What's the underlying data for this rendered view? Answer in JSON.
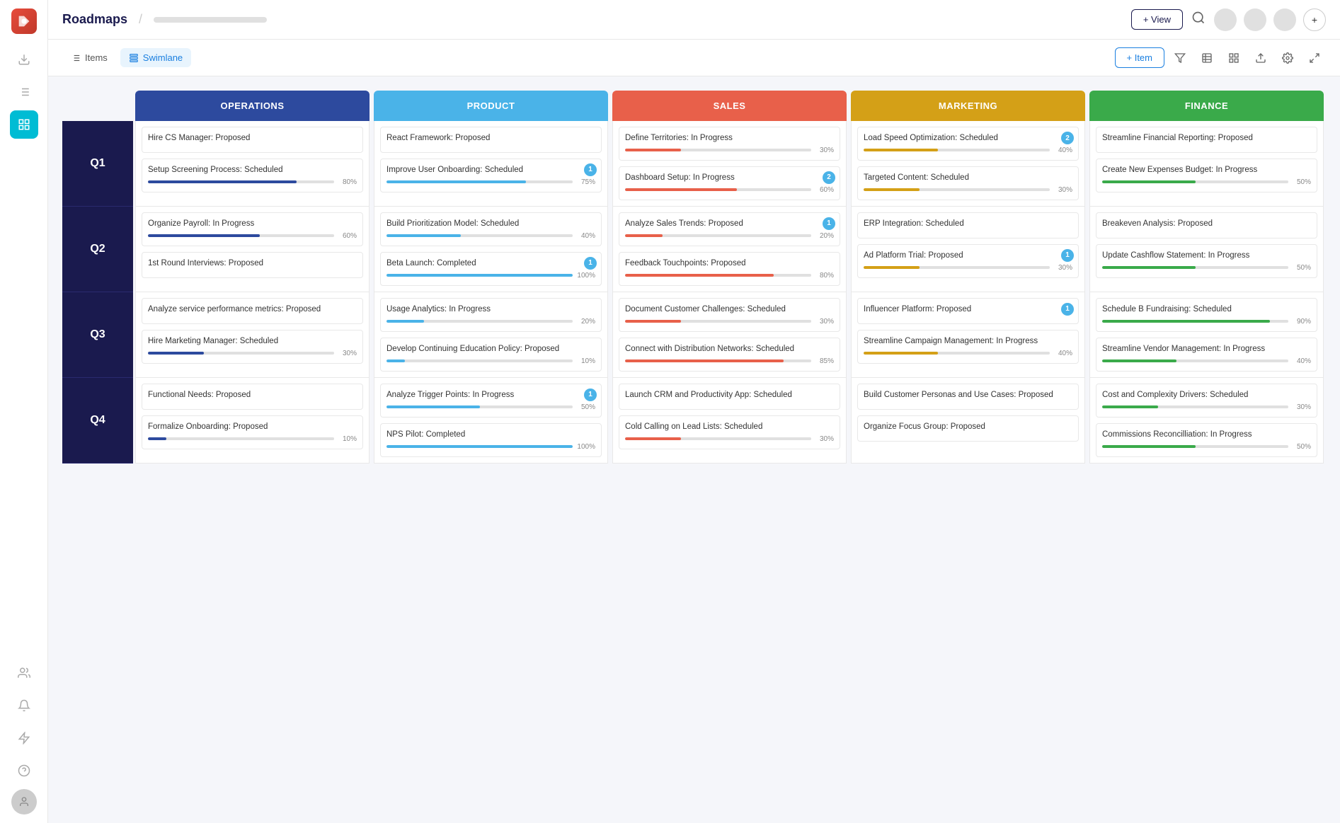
{
  "app": {
    "logo_alt": "Roadmaps App",
    "title": "Roadmaps",
    "breadcrumb_placeholder": ""
  },
  "topbar": {
    "title": "Roadmaps",
    "add_view_label": "+ View",
    "search_icon": "search",
    "user_icons": [
      "user1",
      "user2",
      "user3"
    ],
    "add_icon": "+"
  },
  "toolbar": {
    "items_label": "Items",
    "swimlane_label": "Swimlane",
    "add_item_label": "+ Item",
    "icons": [
      "filter",
      "table",
      "layout",
      "export",
      "settings",
      "expand"
    ]
  },
  "columns": [
    {
      "id": "operations",
      "label": "OPERATIONS",
      "class": "operations"
    },
    {
      "id": "product",
      "label": "PRODUCT",
      "class": "product"
    },
    {
      "id": "sales",
      "label": "SALES",
      "class": "sales"
    },
    {
      "id": "marketing",
      "label": "MARKETING",
      "class": "marketing"
    },
    {
      "id": "finance",
      "label": "FINANCE",
      "class": "finance"
    }
  ],
  "quarters": [
    {
      "label": "Q1",
      "cells": [
        {
          "col": "operations",
          "cards": [
            {
              "title": "Hire CS Manager: Proposed",
              "badge": null,
              "progress": null,
              "bar_color": null
            },
            {
              "title": "Setup Screening Process: Scheduled",
              "badge": null,
              "progress": 80,
              "bar_color": "bar-blue"
            }
          ]
        },
        {
          "col": "product",
          "cards": [
            {
              "title": "React Framework: Proposed",
              "badge": null,
              "progress": null,
              "bar_color": null
            },
            {
              "title": "Improve User Onboarding: Scheduled",
              "badge": "1",
              "progress": 75,
              "bar_color": "bar-light-blue"
            }
          ]
        },
        {
          "col": "sales",
          "cards": [
            {
              "title": "Define Territories: In Progress",
              "badge": null,
              "progress": 30,
              "bar_color": "bar-red"
            },
            {
              "title": "Dashboard Setup: In Progress",
              "badge": "2",
              "progress": 60,
              "bar_color": "bar-red"
            }
          ]
        },
        {
          "col": "marketing",
          "cards": [
            {
              "title": "Load Speed Optimization: Scheduled",
              "badge": "2",
              "progress": 40,
              "bar_color": "bar-yellow"
            },
            {
              "title": "Targeted Content: Scheduled",
              "badge": null,
              "progress": 30,
              "bar_color": "bar-yellow"
            }
          ]
        },
        {
          "col": "finance",
          "cards": [
            {
              "title": "Streamline Financial Reporting: Proposed",
              "badge": null,
              "progress": null,
              "bar_color": null
            },
            {
              "title": "Create New Expenses Budget: In Progress",
              "badge": null,
              "progress": 50,
              "bar_color": "bar-green"
            }
          ]
        }
      ]
    },
    {
      "label": "Q2",
      "cells": [
        {
          "col": "operations",
          "cards": [
            {
              "title": "Organize Payroll: In Progress",
              "badge": null,
              "progress": 60,
              "bar_color": "bar-blue"
            },
            {
              "title": "1st Round Interviews: Proposed",
              "badge": null,
              "progress": null,
              "bar_color": null
            }
          ]
        },
        {
          "col": "product",
          "cards": [
            {
              "title": "Build Prioritization Model: Scheduled",
              "badge": null,
              "progress": 40,
              "bar_color": "bar-light-blue"
            },
            {
              "title": "Beta Launch: Completed",
              "badge": "1",
              "progress": 100,
              "bar_color": "bar-light-blue"
            }
          ]
        },
        {
          "col": "sales",
          "cards": [
            {
              "title": "Analyze Sales Trends: Proposed",
              "badge": "1",
              "progress": 20,
              "bar_color": "bar-red"
            },
            {
              "title": "Feedback Touchpoints: Proposed",
              "badge": null,
              "progress": 80,
              "bar_color": "bar-red"
            }
          ]
        },
        {
          "col": "marketing",
          "cards": [
            {
              "title": "ERP Integration: Scheduled",
              "badge": null,
              "progress": null,
              "bar_color": null
            },
            {
              "title": "Ad Platform Trial: Proposed",
              "badge": "1",
              "progress": 30,
              "bar_color": "bar-yellow"
            }
          ]
        },
        {
          "col": "finance",
          "cards": [
            {
              "title": "Breakeven Analysis: Proposed",
              "badge": null,
              "progress": null,
              "bar_color": null
            },
            {
              "title": "Update Cashflow Statement: In Progress",
              "badge": null,
              "progress": 50,
              "bar_color": "bar-green"
            }
          ]
        }
      ]
    },
    {
      "label": "Q3",
      "cells": [
        {
          "col": "operations",
          "cards": [
            {
              "title": "Analyze service performance metrics: Proposed",
              "badge": null,
              "progress": null,
              "bar_color": null
            },
            {
              "title": "Hire Marketing Manager: Scheduled",
              "badge": null,
              "progress": 30,
              "bar_color": "bar-blue"
            }
          ]
        },
        {
          "col": "product",
          "cards": [
            {
              "title": "Usage Analytics: In Progress",
              "badge": null,
              "progress": 20,
              "bar_color": "bar-light-blue"
            },
            {
              "title": "Develop Continuing Education Policy: Proposed",
              "badge": null,
              "progress": 10,
              "bar_color": "bar-light-blue"
            }
          ]
        },
        {
          "col": "sales",
          "cards": [
            {
              "title": "Document Customer Challenges: Scheduled",
              "badge": null,
              "progress": 30,
              "bar_color": "bar-red"
            },
            {
              "title": "Connect with Distribution Networks: Scheduled",
              "badge": null,
              "progress": 85,
              "bar_color": "bar-red"
            }
          ]
        },
        {
          "col": "marketing",
          "cards": [
            {
              "title": "Influencer Platform: Proposed",
              "badge": "1",
              "progress": null,
              "bar_color": null
            },
            {
              "title": "Streamline Campaign Management: In Progress",
              "badge": null,
              "progress": 40,
              "bar_color": "bar-yellow"
            }
          ]
        },
        {
          "col": "finance",
          "cards": [
            {
              "title": "Schedule B Fundraising: Scheduled",
              "badge": null,
              "progress": 90,
              "bar_color": "bar-green"
            },
            {
              "title": "Streamline Vendor Management: In Progress",
              "badge": null,
              "progress": 40,
              "bar_color": "bar-green"
            }
          ]
        }
      ]
    },
    {
      "label": "Q4",
      "cells": [
        {
          "col": "operations",
          "cards": [
            {
              "title": "Functional Needs: Proposed",
              "badge": null,
              "progress": null,
              "bar_color": null
            },
            {
              "title": "Formalize Onboarding: Proposed",
              "badge": null,
              "progress": 10,
              "bar_color": "bar-blue"
            }
          ]
        },
        {
          "col": "product",
          "cards": [
            {
              "title": "Analyze Trigger Points: In Progress",
              "badge": "1",
              "progress": 50,
              "bar_color": "bar-light-blue"
            },
            {
              "title": "NPS Pilot: Completed",
              "badge": null,
              "progress": 100,
              "bar_color": "bar-light-blue"
            }
          ]
        },
        {
          "col": "sales",
          "cards": [
            {
              "title": "Launch CRM and Productivity App: Scheduled",
              "badge": null,
              "progress": null,
              "bar_color": null
            },
            {
              "title": "Cold Calling on Lead Lists: Scheduled",
              "badge": null,
              "progress": 30,
              "bar_color": "bar-red"
            }
          ]
        },
        {
          "col": "marketing",
          "cards": [
            {
              "title": "Build Customer Personas and Use Cases: Proposed",
              "badge": null,
              "progress": null,
              "bar_color": null
            },
            {
              "title": "Organize Focus Group: Proposed",
              "badge": null,
              "progress": null,
              "bar_color": null
            }
          ]
        },
        {
          "col": "finance",
          "cards": [
            {
              "title": "Cost and Complexity Drivers: Scheduled",
              "badge": null,
              "progress": 30,
              "bar_color": "bar-green"
            },
            {
              "title": "Commissions Reconcilliation: In Progress",
              "badge": null,
              "progress": 50,
              "bar_color": "bar-green"
            }
          ]
        }
      ]
    }
  ],
  "sidebar": {
    "items": [
      {
        "id": "download",
        "icon": "⬇",
        "active": false
      },
      {
        "id": "list",
        "icon": "≡",
        "active": false
      },
      {
        "id": "roadmap",
        "icon": "≡",
        "active": true,
        "teal": false,
        "dark": true
      },
      {
        "id": "person",
        "icon": "👤",
        "active": false
      },
      {
        "id": "bell",
        "icon": "🔔",
        "active": false
      },
      {
        "id": "lightning",
        "icon": "⚡",
        "active": false
      },
      {
        "id": "help",
        "icon": "?",
        "active": false
      }
    ]
  }
}
